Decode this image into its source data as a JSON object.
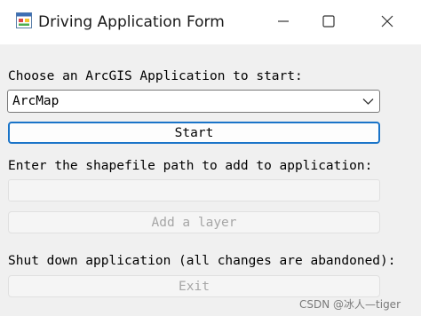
{
  "window": {
    "title": "Driving Application Form",
    "icon": "windows-form-icon",
    "controls": [
      "minimize-icon",
      "maximize-icon",
      "close-icon"
    ]
  },
  "form": {
    "choose_label": "Choose an ArcGIS Application to start:",
    "application_select": {
      "value": "ArcMap"
    },
    "start_button": "Start",
    "shapefile_label": "Enter the shapefile path to add to application:",
    "shapefile_input": {
      "value": "",
      "enabled": false
    },
    "add_layer_button": {
      "label": "Add a layer",
      "enabled": false
    },
    "shutdown_label": "Shut down application (all changes are abandoned):",
    "exit_button": {
      "label": "Exit",
      "enabled": false
    }
  },
  "watermark": "CSDN @冰人—tiger",
  "colors": {
    "focus_border": "#1a74c8",
    "disabled_text": "#a6a6a6",
    "window_background": "#f0f0f0"
  }
}
